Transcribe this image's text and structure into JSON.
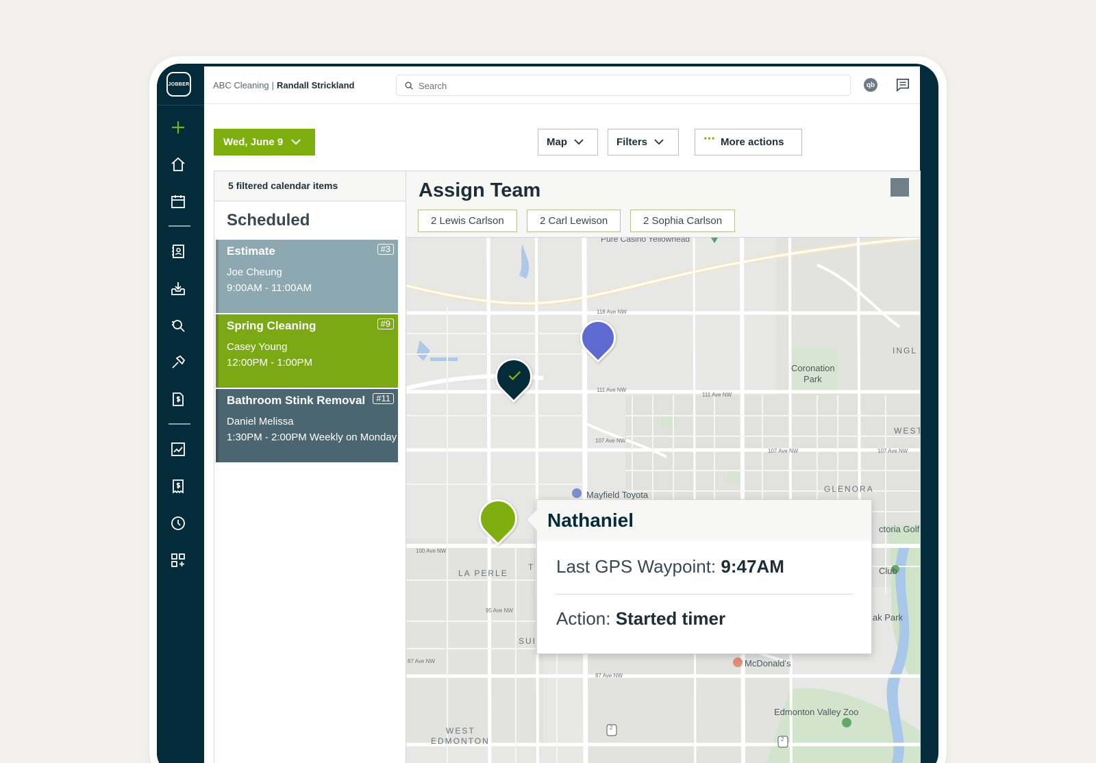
{
  "brand": {
    "logo_text": "JOBBER"
  },
  "topbar": {
    "company": "ABC Cleaning",
    "separator": "|",
    "user": "Randall Strickland",
    "search_placeholder": "Search",
    "qb_icon_text": "qb"
  },
  "sidebar": {
    "icons": [
      "plus-icon",
      "home-icon",
      "calendar-icon",
      "contacts-icon",
      "requests-icon",
      "quotes-icon",
      "jobs-icon",
      "invoices-icon",
      "reports-icon",
      "expenses-icon",
      "timesheet-icon",
      "apps-icon"
    ]
  },
  "toolbar": {
    "date_label": "Wed, June 9",
    "map_label": "Map",
    "filters_label": "Filters",
    "more_actions_label": "More actions"
  },
  "list": {
    "header": "5 filtered calendar items",
    "section_title": "Scheduled",
    "items": [
      {
        "title": "Estimate",
        "number": "#3",
        "customer": "Joe Cheung",
        "time": "9:00AM - 11:00AM",
        "color": "#8ea8b1"
      },
      {
        "title": "Spring Cleaning",
        "number": "#9",
        "customer": "Casey Young",
        "time": "12:00PM - 1:00PM",
        "color": "#7aa915"
      },
      {
        "title": "Bathroom Stink Removal",
        "number": "#11",
        "customer": "Daniel Melissa",
        "time": "1:30PM - 2:00PM Weekly on Monday",
        "color": "#4b6671"
      }
    ]
  },
  "assign": {
    "title": "Assign Team",
    "chips": [
      "2 Lewis Carlson",
      "2 Carl Lewison",
      "2 Sophia Carlson"
    ]
  },
  "map": {
    "labels": {
      "pure_casino": "Pure Casino Yellowhead",
      "coronation_park": "Coronation",
      "coronation_park2": "Park",
      "inglewood": "INGL",
      "westmount": "WEST",
      "glenora": "GLENORA",
      "victoria_golf": "ctoria Golf",
      "club": "Club",
      "la_perle": "LA PERLE",
      "mayfield_toyota": "Mayfield Toyota",
      "mcdonalds": "McDonald's",
      "edmonton_valley_zoo": "Edmonton Valley Zoo",
      "west_edmonton_1": "WEST",
      "west_edmonton_2": "EDMONTON",
      "laurier_park": "lak Park",
      "sun": "SUI",
      "t_partial": "T",
      "ave_118": "118 Ave NW",
      "ave_111": "111 Ave NW",
      "ave_111b": "111 Ave NW",
      "ave_107": "107 Ave NW",
      "ave_107b": "107 Ave NW",
      "ave_107c": "107 Ave NW",
      "ave_100": "100 Ave NW",
      "ave_95": "95 Ave NW",
      "ave_87": "87 Ave NW",
      "ave_87b": "87 Ave NW",
      "route_2a": "2",
      "route_2b": "2"
    },
    "pins": [
      {
        "name": "pin-blue",
        "color": "#5e6ad0"
      },
      {
        "name": "pin-completed",
        "color": "#032b3a"
      },
      {
        "name": "pin-nathaniel",
        "color": "#7db00e"
      }
    ]
  },
  "popup": {
    "name": "Nathaniel",
    "gps_label": "Last GPS Waypoint:",
    "gps_value": "9:47AM",
    "action_label": "Action:",
    "action_value": "Started timer"
  }
}
